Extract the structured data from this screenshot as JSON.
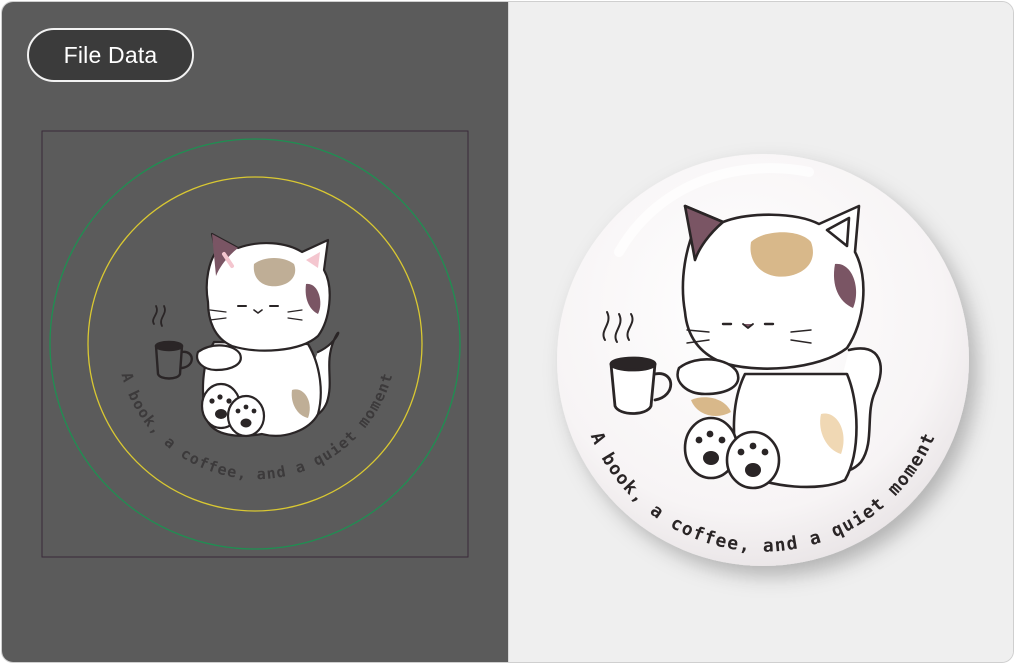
{
  "toolbar": {
    "file_data_label": "File Data"
  },
  "design": {
    "caption": "A book, a coffee, and a quiet moment",
    "icons": [
      "cat-illustration-icon",
      "coffee-cup-icon",
      "paw-icon"
    ]
  },
  "preview": {
    "caption": "A book, a coffee, and a quiet moment"
  },
  "colors": {
    "left_bg": "#5b5b5b",
    "right_bg": "#efefef",
    "outer_guide": "#1f8f52",
    "inner_guide": "#d9c832",
    "artboard_border": "#3a2a3a",
    "ear_patch": "#7a5564",
    "tan_patch": "#d8b88a",
    "outline": "#2a2526"
  }
}
